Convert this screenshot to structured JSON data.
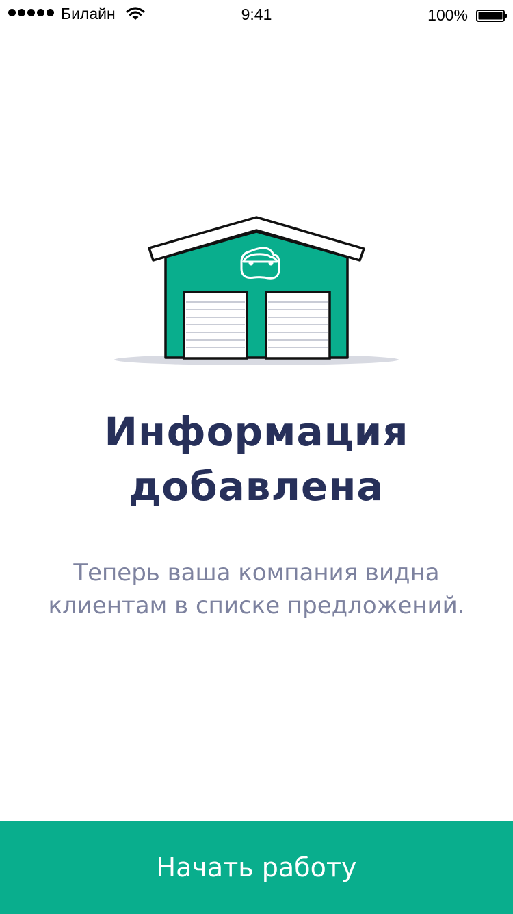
{
  "status_bar": {
    "carrier": "Билайн",
    "time": "9:41",
    "battery": "100%"
  },
  "illustration": {
    "name": "garage-illustration",
    "colors": {
      "wall": "#09ae8d",
      "outline": "#111111",
      "shadow": "#d8dae2"
    }
  },
  "main": {
    "title_line1": "Информация",
    "title_line2": "добавлена",
    "description_line1": "Теперь ваша компания видна",
    "description_line2": "клиентам в списке предложений."
  },
  "cta": {
    "label": "Начать работу",
    "color": "#09ae8d"
  }
}
